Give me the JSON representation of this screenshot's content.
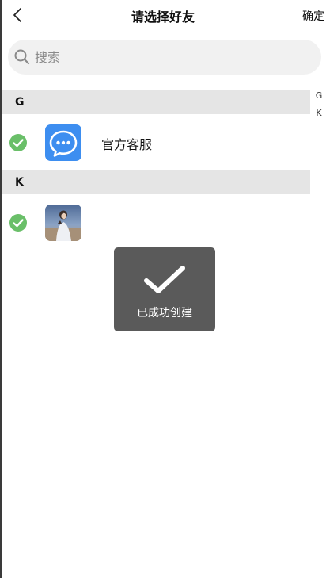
{
  "header": {
    "title": "请选择好友",
    "confirm_label": "确定"
  },
  "search": {
    "placeholder": "搜索"
  },
  "sections": [
    {
      "letter": "G",
      "items": [
        {
          "name": "官方客服",
          "checked": true,
          "avatar": "chat-bubble-icon"
        }
      ]
    },
    {
      "letter": "K",
      "items": [
        {
          "name": "",
          "checked": true,
          "avatar": "photo-avatar"
        }
      ]
    }
  ],
  "index_bar": [
    "G",
    "K"
  ],
  "toast": {
    "message": "已成功创建",
    "icon": "checkmark-icon"
  },
  "colors": {
    "check_green": "#6abf69",
    "service_blue": "#3d8ef0",
    "section_bg": "#e5e5e5",
    "toast_bg": "#5a5a5a"
  }
}
